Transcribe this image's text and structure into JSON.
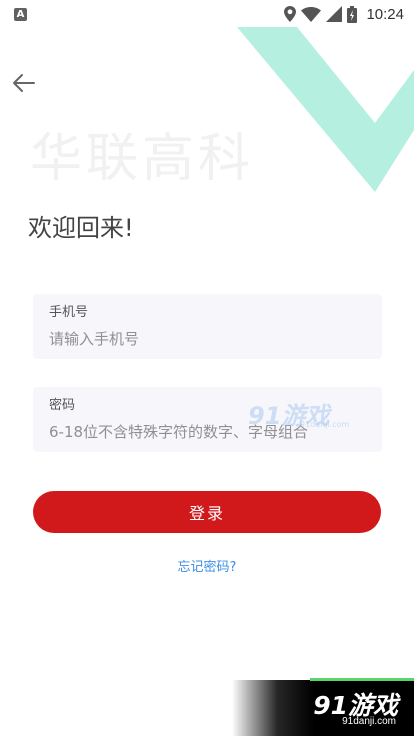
{
  "status_bar": {
    "app_badge": "A",
    "time": "10:24",
    "icons": [
      "location-icon",
      "wifi-icon",
      "cellular-signal-icon",
      "battery-icon"
    ]
  },
  "brand_watermark": "华联高科",
  "welcome": "欢迎回来!",
  "phone_field": {
    "label": "手机号",
    "placeholder": "请输入手机号",
    "value": ""
  },
  "password_field": {
    "label": "密码",
    "placeholder": "6-18位不含特殊字符的数字、字母组合",
    "value": ""
  },
  "login_button": "登录",
  "forgot_password": "忘记密码?",
  "watermark": {
    "center_text": "91游戏",
    "center_sub": "91danji.com",
    "footer_logo": "91游戏",
    "footer_url": "91danji.com"
  },
  "colors": {
    "accent_red": "#d1191c",
    "link_blue": "#3a8ee6",
    "decor_mint": "#b4efe0",
    "input_bg": "#f7f7fb"
  }
}
